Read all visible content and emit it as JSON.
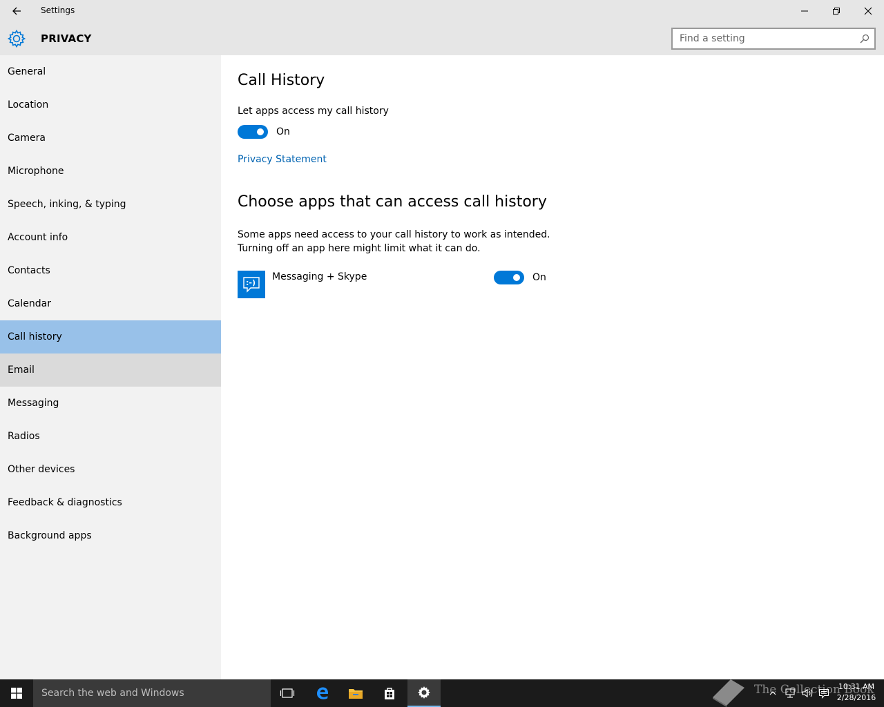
{
  "window": {
    "title": "Settings",
    "back_icon": "arrow-left-icon",
    "minimize_icon": "minimize-icon",
    "maximize_icon": "restore-icon",
    "close_icon": "close-icon"
  },
  "header": {
    "icon": "gear-icon",
    "section": "PRIVACY",
    "search_placeholder": "Find a setting",
    "search_value": ""
  },
  "sidebar": {
    "items": [
      {
        "label": "General"
      },
      {
        "label": "Location"
      },
      {
        "label": "Camera"
      },
      {
        "label": "Microphone"
      },
      {
        "label": "Speech, inking, & typing"
      },
      {
        "label": "Account info"
      },
      {
        "label": "Contacts"
      },
      {
        "label": "Calendar"
      },
      {
        "label": "Call history",
        "selected": true
      },
      {
        "label": "Email",
        "hover": true
      },
      {
        "label": "Messaging"
      },
      {
        "label": "Radios"
      },
      {
        "label": "Other devices"
      },
      {
        "label": "Feedback & diagnostics"
      },
      {
        "label": "Background apps"
      }
    ]
  },
  "main": {
    "title": "Call History",
    "toggle_label": "Let apps access my call history",
    "toggle_state": "On",
    "privacy_link": "Privacy Statement",
    "apps_heading": "Choose apps that can access call history",
    "apps_desc_line1": "Some apps need access to your call history to work as intended.",
    "apps_desc_line2": "Turning off an app here might limit what it can do.",
    "apps": [
      {
        "name": "Messaging + Skype",
        "tile_text": ":-)",
        "state": "On"
      }
    ]
  },
  "taskbar": {
    "search_placeholder": "Search the web and Windows",
    "time": "10:31 AM",
    "date": "2/28/2016",
    "watermark": "The Collection Book"
  },
  "colors": {
    "accent": "#0078d7",
    "selected_nav": "#98c1e9",
    "link": "#0063b1"
  }
}
